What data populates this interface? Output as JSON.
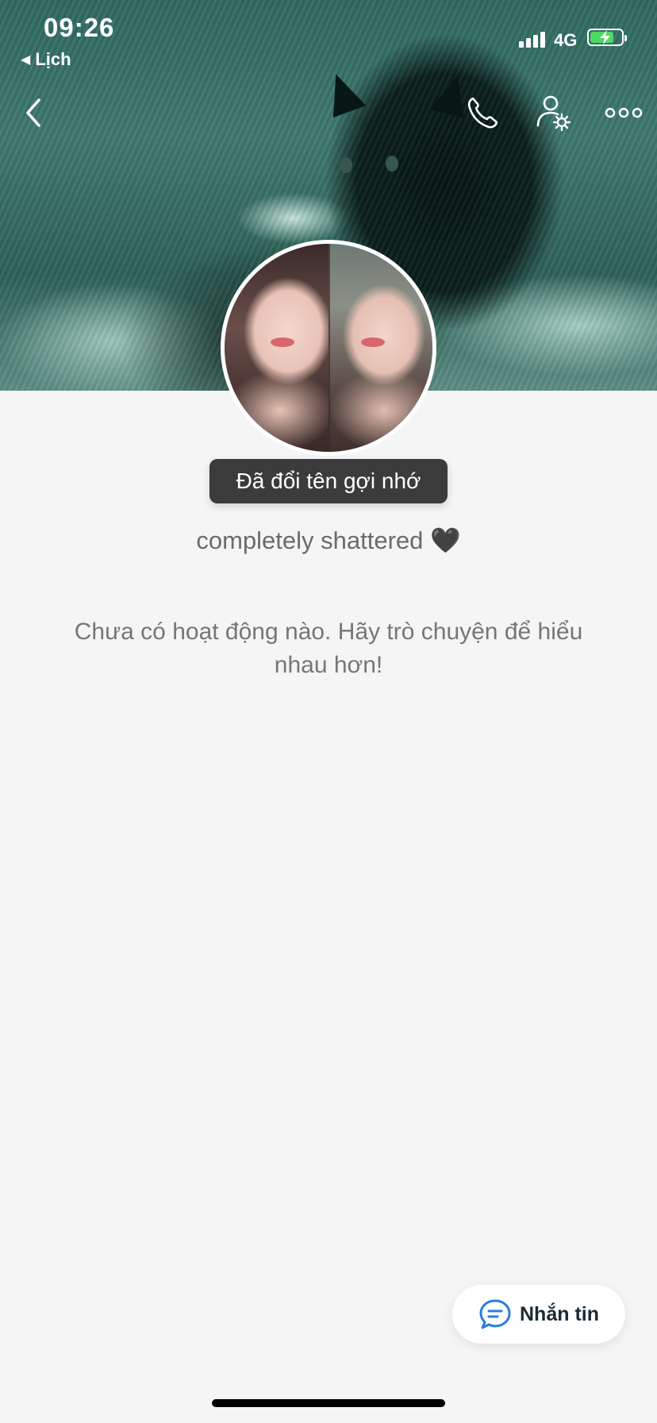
{
  "status_bar": {
    "time": "09:26",
    "back_app": "Lịch",
    "network": "4G",
    "battery_level": 0.75,
    "battery_color": "#4cd964"
  },
  "nav": {
    "back_icon": "chevron-left-icon",
    "call_icon": "phone-icon",
    "settings_icon": "user-settings-icon",
    "more_icon": "more-horizontal-icon"
  },
  "profile": {
    "toast": "Đã đổi tên gợi nhớ",
    "status": "completely shattered",
    "status_emoji": "🖤",
    "empty_activity": "Chưa có hoạt động nào. Hãy trò chuyện để hiểu nhau hơn!"
  },
  "actions": {
    "message_label": "Nhắn tin",
    "message_icon": "chat-bubble-icon",
    "accent": "#2a7de1"
  }
}
